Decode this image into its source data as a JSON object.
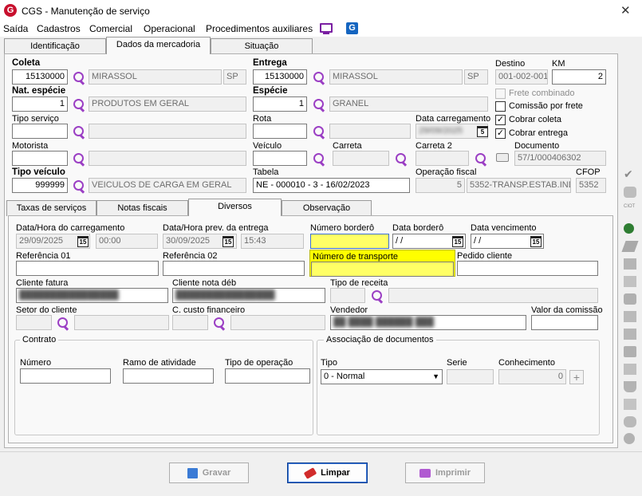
{
  "window": {
    "title": "CGS - Manutenção de serviço"
  },
  "menu": {
    "items": [
      "Saída",
      "Cadastros",
      "Comercial",
      "Operacional",
      "Procedimentos auxiliares"
    ]
  },
  "tabs_top": [
    {
      "label": "Identificação"
    },
    {
      "label": "Dados da mercadoria"
    },
    {
      "label": "Situação"
    }
  ],
  "top": {
    "coleta": {
      "label": "Coleta",
      "code": "15130000",
      "city": "MIRASSOL",
      "uf": "SP"
    },
    "entrega": {
      "label": "Entrega",
      "code": "15130000",
      "city": "MIRASSOL",
      "uf": "SP"
    },
    "destino": {
      "label": "Destino",
      "value": "001-002-001"
    },
    "km": {
      "label": "KM",
      "value": "2"
    },
    "nat_especie": {
      "label": "Nat. espécie",
      "code": "1",
      "desc": "PRODUTOS EM GERAL"
    },
    "especie": {
      "label": "Espécie",
      "code": "1",
      "desc": "GRANEL"
    },
    "tipo_servico": {
      "label": "Tipo serviço"
    },
    "rota": {
      "label": "Rota"
    },
    "data_carregamento": {
      "label": "Data carregamento",
      "value": "29/09/2025"
    },
    "motorista": {
      "label": "Motorista"
    },
    "veiculo": {
      "label": "Veículo"
    },
    "carreta": {
      "label": "Carreta"
    },
    "carreta2": {
      "label": "Carreta 2"
    },
    "documento": {
      "label": "Documento",
      "value": "57/1/000406302"
    },
    "tipo_veiculo": {
      "label": "Tipo veículo",
      "code": "999999",
      "desc": "VEICULOS DE CARGA EM GERAL"
    },
    "tabela": {
      "label": "Tabela",
      "value": "NE - 000010 - 3 - 16/02/2023"
    },
    "operacao_fiscal": {
      "label": "Operação fiscal",
      "code": "5",
      "desc": "5352-TRANSP.ESTAB.IND"
    },
    "cfop": {
      "label": "CFOP",
      "value": "5352"
    },
    "checks": {
      "frete_combinado": "Frete combinado",
      "comissao_frete": "Comissão por frete",
      "cobrar_coleta": "Cobrar coleta",
      "cobrar_entrega": "Cobrar entrega"
    }
  },
  "tabs_bottom": [
    {
      "label": "Taxas de serviços"
    },
    {
      "label": "Notas fiscais"
    },
    {
      "label": "Diversos"
    },
    {
      "label": "Observação"
    }
  ],
  "diversos": {
    "data_hora_carregamento": {
      "label": "Data/Hora do carregamento",
      "date": "29/09/2025",
      "time": "00:00"
    },
    "data_hora_prev_entrega": {
      "label": "Data/Hora prev. da entrega",
      "date": "30/09/2025",
      "time": "15:43"
    },
    "numero_bordero": {
      "label": "Número borderô",
      "value": ""
    },
    "data_bordero": {
      "label": "Data borderô",
      "value": " / /"
    },
    "data_vencimento": {
      "label": "Data vencimento",
      "value": " / /"
    },
    "referencia01": {
      "label": "Referência 01"
    },
    "referencia02": {
      "label": "Referência 02"
    },
    "numero_transporte": {
      "label": "Número de transporte",
      "value": ""
    },
    "pedido_cliente": {
      "label": "Pedido cliente"
    },
    "cliente_fatura": {
      "label": "Cliente fatura"
    },
    "cliente_nota_deb": {
      "label": "Cliente nota déb"
    },
    "tipo_receita": {
      "label": "Tipo de receita"
    },
    "setor_cliente": {
      "label": "Setor do cliente"
    },
    "custo_financeiro": {
      "label": "C. custo financeiro"
    },
    "vendedor": {
      "label": "Vendedor"
    },
    "valor_comissao": {
      "label": "Valor da comissão"
    }
  },
  "contrato": {
    "title": "Contrato",
    "numero": "Número",
    "ramo": "Ramo de atividade",
    "tipo_operacao": "Tipo de operação"
  },
  "associacao": {
    "title": "Associação de documentos",
    "tipo_label": "Tipo",
    "tipo_value": "0 - Normal",
    "serie_label": "Serie",
    "conhecimento_label": "Conhecimento",
    "conhecimento_value": "0"
  },
  "buttons": {
    "gravar": "Gravar",
    "limpar": "Limpar",
    "imprimir": "Imprimir"
  },
  "colors": {
    "accent": "#9b3fc4",
    "highlight": "#ffff66",
    "title_logo": "#c8102e"
  }
}
